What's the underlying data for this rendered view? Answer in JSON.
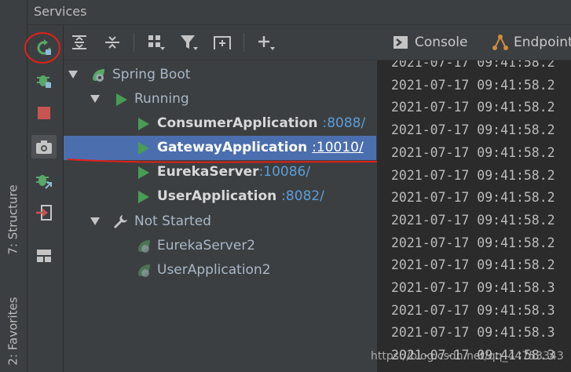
{
  "window": {
    "title": "Services"
  },
  "side_tabs": {
    "structure": "7: Structure",
    "favorites": "2: Favorites"
  },
  "actions": [
    {
      "name": "rerun-icon"
    },
    {
      "name": "debug-icon"
    },
    {
      "name": "stop-icon"
    },
    {
      "name": "camera-icon"
    },
    {
      "name": "attach-debugger-icon"
    },
    {
      "name": "exit-icon"
    },
    {
      "name": "layout-icon"
    }
  ],
  "tree_toolbar": [
    {
      "name": "expand-all-icon"
    },
    {
      "name": "collapse-all-icon"
    },
    {
      "name": "group-by-icon"
    },
    {
      "name": "filter-icon"
    },
    {
      "name": "new-tab-icon"
    },
    {
      "name": "add-icon"
    }
  ],
  "tree": {
    "root": {
      "label": "Spring Boot"
    },
    "running_group": {
      "label": "Running"
    },
    "running": [
      {
        "name": "ConsumerApplication",
        "port": ":8088/"
      },
      {
        "name": "GatewayApplication",
        "port": ":10010/",
        "selected": true
      },
      {
        "name": "EurekaServer",
        "port": ":10086/"
      },
      {
        "name": "UserApplication",
        "port": ":8082/"
      }
    ],
    "not_started_group": {
      "label": "Not Started"
    },
    "not_started": [
      {
        "name": "EurekaServer2"
      },
      {
        "name": "UserApplication2"
      }
    ]
  },
  "console_tabs": [
    {
      "label": "Console",
      "icon": "console-icon"
    },
    {
      "label": "Endpoint",
      "icon": "endpoints-icon"
    }
  ],
  "console_lines": [
    "2021-07-17 09:41:58.2",
    "2021-07-17 09:41:58.2",
    "2021-07-17 09:41:58.2",
    "2021-07-17 09:41:58.2",
    "2021-07-17 09:41:58.2",
    "2021-07-17 09:41:58.2",
    "2021-07-17 09:41:58.2",
    "2021-07-17 09:41:58.2",
    "2021-07-17 09:41:58.2",
    "2021-07-17 09:41:58.2",
    "2021-07-17 09:41:58.3",
    "2021-07-17 09:41:58.3",
    "2021-07-17 09:41:58.3",
    "2021-07-17 09:41:58.3"
  ],
  "watermark": "https://blog.csdn.net/qq_44753343",
  "colors": {
    "selection": "#4b6eaf",
    "run_green": "#499c54",
    "port_blue": "#5c9ed9",
    "stop_red": "#c75450",
    "annotation_red": "#e0201a"
  }
}
